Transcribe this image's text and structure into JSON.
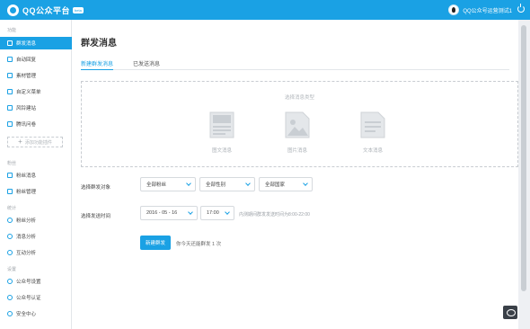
{
  "topbar": {
    "brand": "QQ公众平台",
    "beta": "beta",
    "account_name": "QQ公众号运营测试1",
    "colors": {
      "accent": "#1aa1e4"
    }
  },
  "sidebar": {
    "groups": [
      {
        "title": "功能",
        "items": [
          {
            "label": "群发消息",
            "icon": "broadcast-icon",
            "active": true
          },
          {
            "label": "自动回复",
            "icon": "auto-reply-icon"
          },
          {
            "label": "素材管理",
            "icon": "material-icon"
          },
          {
            "label": "自定义菜单",
            "icon": "custom-menu-icon"
          },
          {
            "label": "风铃建站",
            "icon": "site-builder-icon"
          },
          {
            "label": "腾讯问卷",
            "icon": "survey-icon"
          }
        ],
        "add_button": "添加功能插件"
      },
      {
        "title": "粉丝",
        "items": [
          {
            "label": "粉丝消息",
            "icon": "fan-message-icon"
          },
          {
            "label": "粉丝管理",
            "icon": "fan-manage-icon"
          }
        ]
      },
      {
        "title": "统计",
        "items": [
          {
            "label": "粉丝分析",
            "icon": "fan-analysis-icon"
          },
          {
            "label": "消息分析",
            "icon": "message-analysis-icon"
          },
          {
            "label": "互动分析",
            "icon": "interaction-analysis-icon"
          }
        ]
      },
      {
        "title": "设置",
        "items": [
          {
            "label": "公众号设置",
            "icon": "account-settings-icon"
          },
          {
            "label": "公众号认证",
            "icon": "verification-icon"
          },
          {
            "label": "安全中心",
            "icon": "security-icon"
          }
        ]
      }
    ]
  },
  "main": {
    "title": "群发消息",
    "tabs": [
      {
        "label": "新建群发消息",
        "active": true
      },
      {
        "label": "已发送消息"
      }
    ],
    "type_box": {
      "label": "选择消息类型",
      "types": [
        {
          "label": "图文消息",
          "icon": "news-icon"
        },
        {
          "label": "图片消息",
          "icon": "image-icon"
        },
        {
          "label": "文本消息",
          "icon": "text-icon"
        }
      ]
    },
    "target": {
      "label": "选择群发对象",
      "fans": "全部粉丝",
      "gender": "全部性别",
      "country": "全部国家"
    },
    "time": {
      "label": "选择发送时间",
      "date": "2016 - 05 - 16",
      "hour": "17:00",
      "hint": "内测期间群发发送时间为8:00-22:00"
    },
    "create_button": "新建群发",
    "quota": "你今天还能群发 1 次"
  }
}
